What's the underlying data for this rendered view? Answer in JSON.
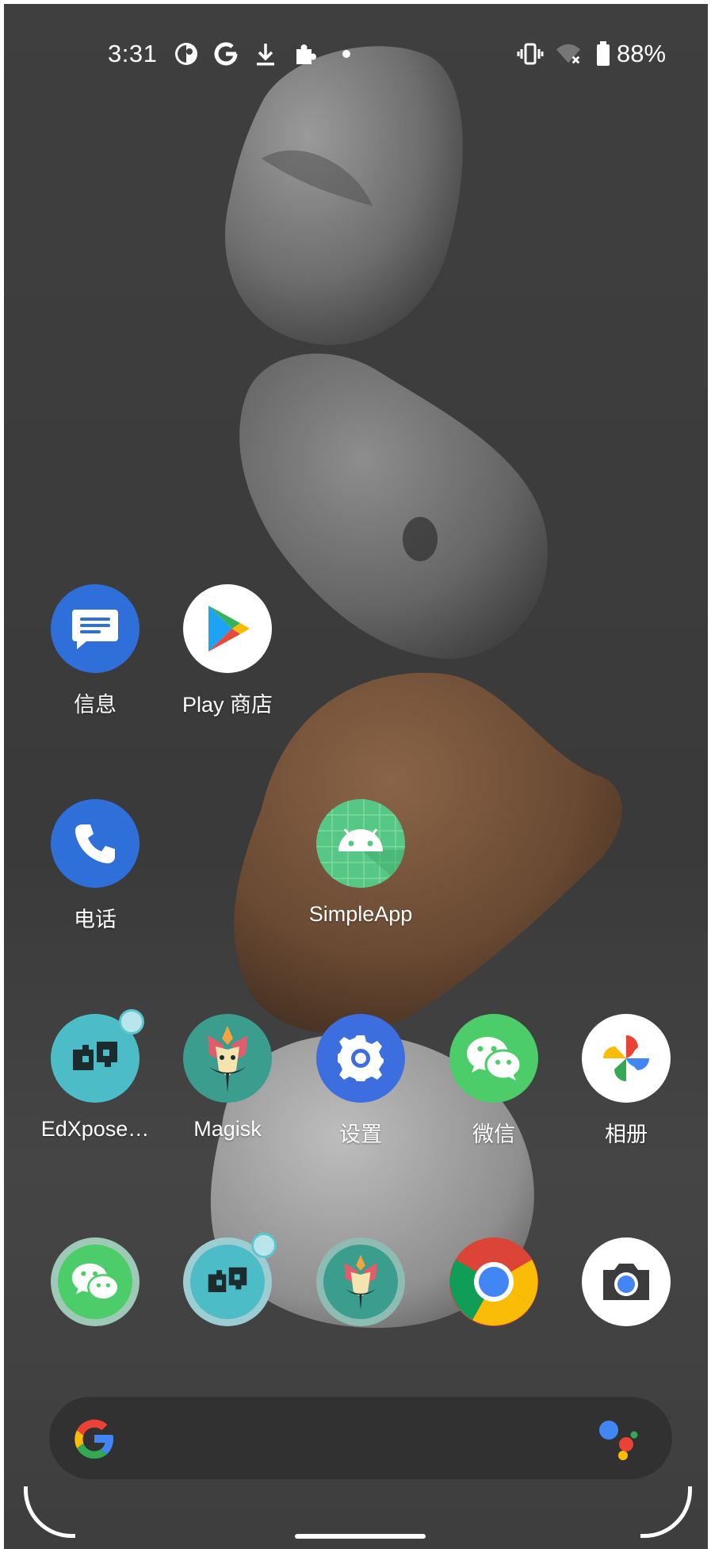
{
  "status_bar": {
    "time": "3:31",
    "left_icons": [
      "pinwheel-icon",
      "google-g-icon",
      "download-icon",
      "puzzle-icon",
      "dot-icon"
    ],
    "right_icons": [
      "vibrate-icon",
      "wifi-off-icon",
      "battery-icon"
    ],
    "battery_percent": "88%"
  },
  "home": {
    "row1": [
      {
        "label": "信息",
        "icon": "messages-icon",
        "color": "#2f6fd9"
      },
      {
        "label": "Play 商店",
        "icon": "play-store-icon",
        "color": "#ffffff"
      }
    ],
    "row2": [
      {
        "label": "电话",
        "icon": "phone-icon",
        "color": "#2f6fd9"
      },
      {
        "label": "SimpleApp",
        "icon": "android-icon",
        "color": "#57c785"
      }
    ],
    "row3": [
      {
        "label": "EdXpose…",
        "icon": "edxposed-icon",
        "color": "#4cbcc6"
      },
      {
        "label": "Magisk",
        "icon": "magisk-icon",
        "color": "#3a9d8e"
      },
      {
        "label": "设置",
        "icon": "settings-icon",
        "color": "#3d6ee0"
      },
      {
        "label": "微信",
        "icon": "wechat-icon",
        "color": "#4ccd6a"
      },
      {
        "label": "相册",
        "icon": "photos-icon",
        "color": "#ffffff"
      }
    ],
    "dock": [
      {
        "icon": "wechat-icon"
      },
      {
        "icon": "edxposed-icon"
      },
      {
        "icon": "magisk-icon"
      },
      {
        "icon": "chrome-icon"
      },
      {
        "icon": "camera-icon"
      }
    ]
  },
  "search_bar": {
    "left_icon": "google-logo-icon",
    "right_icon": "assistant-icon"
  }
}
